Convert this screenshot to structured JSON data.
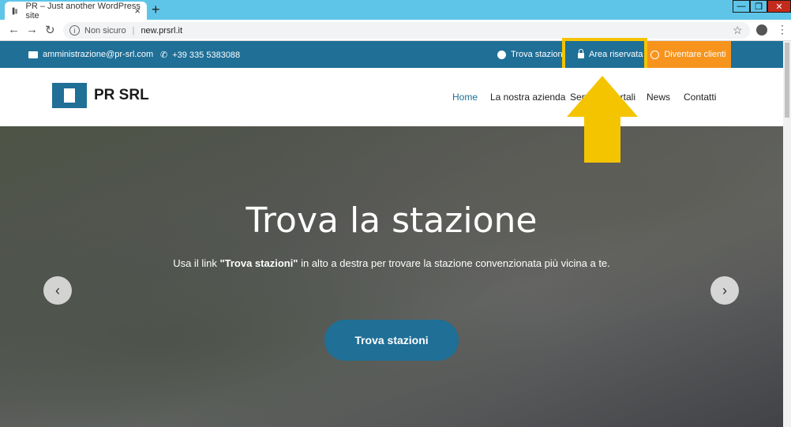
{
  "browser": {
    "tab_title": "PR – Just another WordPress site",
    "tab_close": "×",
    "new_tab": "+",
    "security_label": "Non sicuro",
    "url": "new.prsrl.it",
    "win_min": "—",
    "win_max": "❐",
    "win_close": "✕"
  },
  "topbar": {
    "email": "amministrazione@pr-srl.com",
    "phone": "+39 335 5383088",
    "trova_stazioni": "Trova stazioni",
    "area_riservata": "Area riservata",
    "diventare_clienti": "Diventare clienti"
  },
  "header": {
    "logo_text": "PR SRL",
    "nav": [
      "Home",
      "La nostra azienda",
      "Servizi",
      "Portali",
      "News",
      "Contatti"
    ]
  },
  "hero": {
    "title": "Trova la stazione",
    "subtitle_pre": "Usa il link ",
    "subtitle_bold": "\"Trova stazioni\"",
    "subtitle_post": " in alto a destra per trovare la stazione convenzionata più vicina a te.",
    "button": "Trova stazioni",
    "prev": "‹",
    "next": "›"
  },
  "colors": {
    "brand_blue": "#1f6f97",
    "orange": "#f7941d",
    "highlight_yellow": "#f5c400"
  }
}
